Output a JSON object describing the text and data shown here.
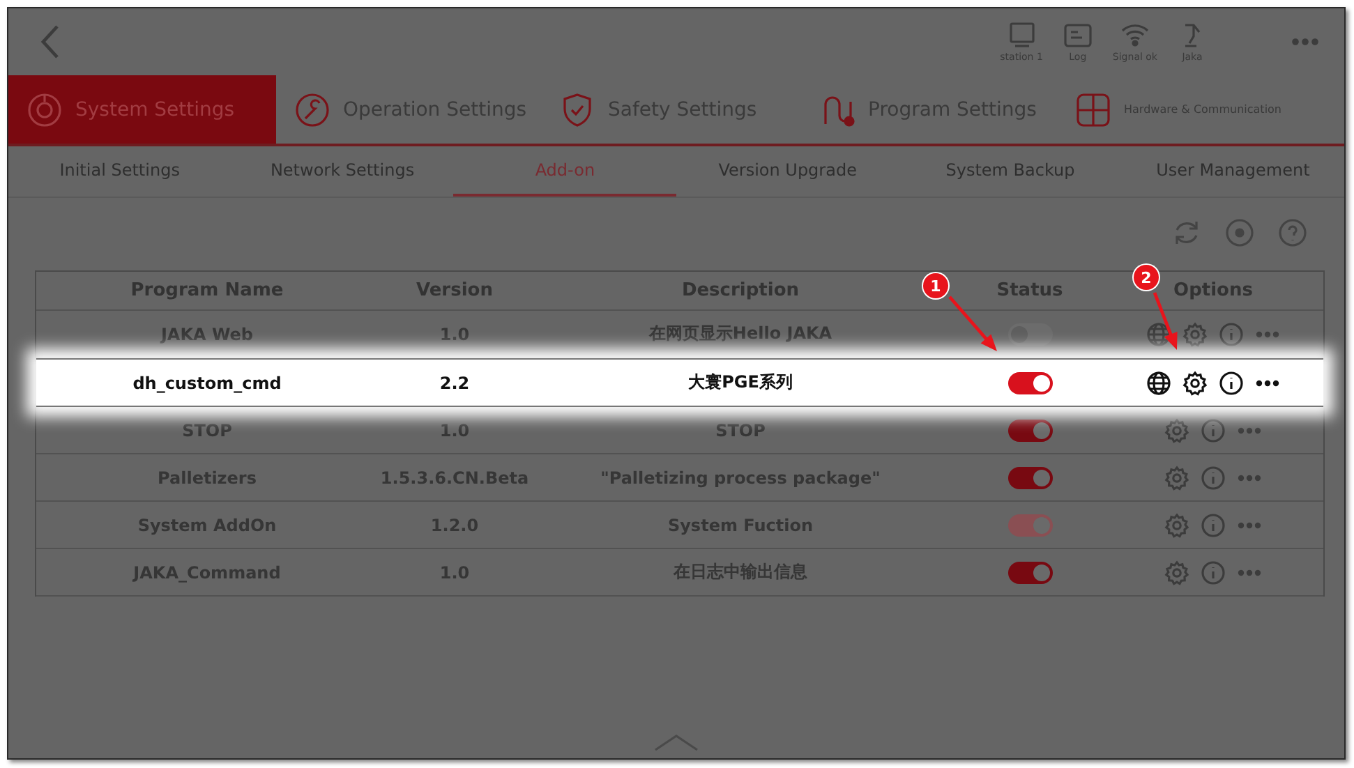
{
  "status_bar": {
    "items": [
      {
        "kind": "station",
        "label": "station 1"
      },
      {
        "kind": "log",
        "label": "Log"
      },
      {
        "kind": "signal",
        "label": "Signal ok"
      },
      {
        "kind": "user",
        "label": "Jaka"
      }
    ]
  },
  "main_tabs": [
    {
      "kind": "system",
      "label": "System Settings",
      "selected": true
    },
    {
      "kind": "operation",
      "label": "Operation Settings",
      "selected": false
    },
    {
      "kind": "safety",
      "label": "Safety Settings",
      "selected": false
    },
    {
      "kind": "program",
      "label": "Program Settings",
      "selected": false
    },
    {
      "kind": "hardware",
      "label": "Hardware & Communication",
      "selected": false
    }
  ],
  "sub_tabs": [
    {
      "label": "Initial Settings",
      "selected": false
    },
    {
      "label": "Network Settings",
      "selected": false
    },
    {
      "label": "Add-on",
      "selected": true
    },
    {
      "label": "Version Upgrade",
      "selected": false
    },
    {
      "label": "System Backup",
      "selected": false
    },
    {
      "label": "User Management",
      "selected": false
    }
  ],
  "table": {
    "columns": [
      "Program Name",
      "Version",
      "Description",
      "Status",
      "Options"
    ],
    "rows": [
      {
        "name": "JAKA Web",
        "version": "1.0",
        "description": "在网页显示Hello JAKA",
        "on": false,
        "disabled": false,
        "web": true,
        "highlighted": false
      },
      {
        "name": "dh_custom_cmd",
        "version": "2.2",
        "description": "大寰PGE系列",
        "on": true,
        "disabled": false,
        "web": true,
        "highlighted": true
      },
      {
        "name": "STOP",
        "version": "1.0",
        "description": "STOP",
        "on": true,
        "disabled": false,
        "web": false,
        "highlighted": false
      },
      {
        "name": "Palletizers",
        "version": "1.5.3.6.CN.Beta",
        "description": "\"Palletizing process package\"",
        "on": true,
        "disabled": false,
        "web": false,
        "highlighted": false
      },
      {
        "name": "System AddOn",
        "version": "1.2.0",
        "description": "System Fuction",
        "on": true,
        "disabled": true,
        "web": false,
        "highlighted": false
      },
      {
        "name": "JAKA_Command",
        "version": "1.0",
        "description": "在日志中输出信息",
        "on": true,
        "disabled": false,
        "web": false,
        "highlighted": false
      }
    ]
  },
  "annotations": [
    {
      "label": "1",
      "kind": "status"
    },
    {
      "label": "2",
      "kind": "options"
    }
  ]
}
